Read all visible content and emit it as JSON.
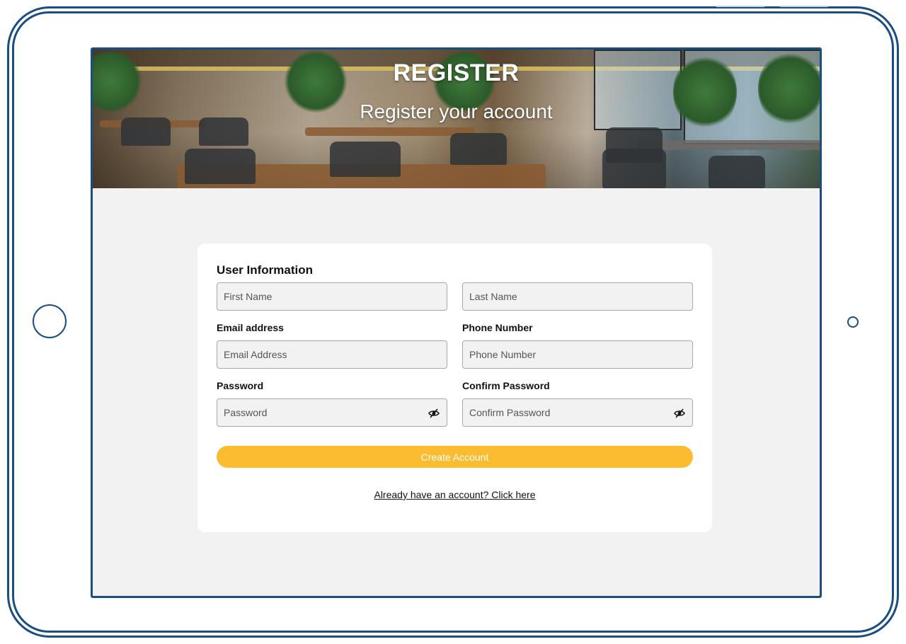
{
  "page": {
    "title": "REGISTER",
    "subtitle": "Register your account"
  },
  "form": {
    "section_title": "User Information",
    "first_name": {
      "placeholder": "First Name",
      "value": ""
    },
    "last_name": {
      "placeholder": "Last Name",
      "value": ""
    },
    "email": {
      "label": "Email address",
      "placeholder": "Email Address",
      "value": ""
    },
    "phone": {
      "label": "Phone Number",
      "placeholder": "Phone Number",
      "value": ""
    },
    "password": {
      "label": "Password",
      "placeholder": "Password",
      "value": "",
      "toggle_icon": "eye-slash-icon"
    },
    "confirm_password": {
      "label": "Confirm Password",
      "placeholder": "Confirm Password",
      "value": "",
      "toggle_icon": "eye-slash-icon"
    },
    "submit_label": "Create Account",
    "login_link": "Already have an account? Click here"
  },
  "colors": {
    "frame": "#1a4d80",
    "screen_background": "#f2f2f2",
    "primary_button": "#fbbd2f"
  }
}
